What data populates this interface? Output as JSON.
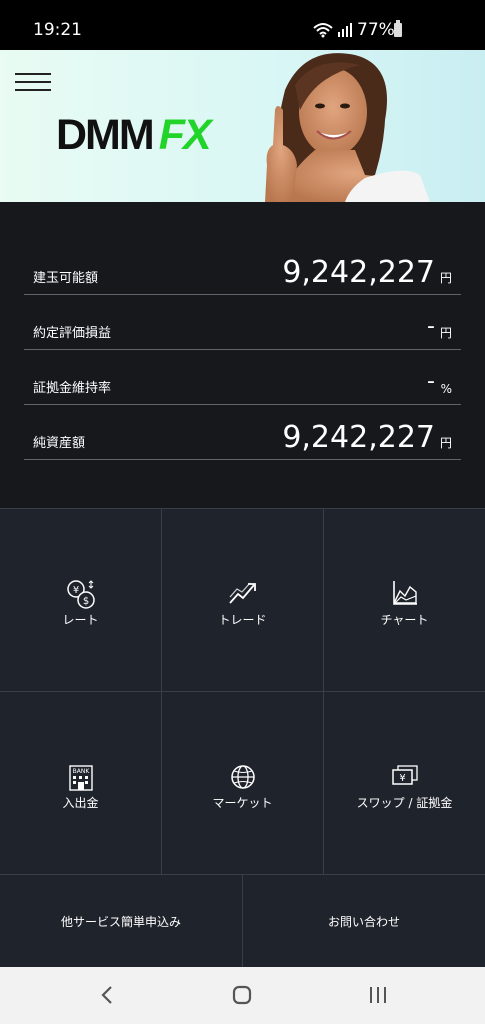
{
  "status": {
    "time": "19:21",
    "battery": "77%"
  },
  "hero": {
    "logo_dmm": "DMM",
    "logo_fx": "FX"
  },
  "summary": [
    {
      "label": "建玉可能額",
      "value": "9,242,227",
      "unit": "円"
    },
    {
      "label": "約定評価損益",
      "value": "-",
      "unit": "円"
    },
    {
      "label": "証拠金維持率",
      "value": "-",
      "unit": "%"
    },
    {
      "label": "純資産額",
      "value": "9,242,227",
      "unit": "円"
    }
  ],
  "menu": {
    "rate": "レート",
    "trade": "トレード",
    "chart": "チャート",
    "deposit": "入出金",
    "market": "マーケット",
    "swap": "スワップ / 証拠金",
    "other_services": "他サービス簡単申込み",
    "contact": "お問い合わせ"
  },
  "icons": {
    "rate": "currency-exchange-icon",
    "trade": "trend-chart-icon",
    "chart": "area-chart-icon",
    "deposit": "bank-icon",
    "market": "globe-icon",
    "swap": "yen-notes-icon"
  },
  "colors": {
    "accent_green": "#22d42a",
    "panel": "#1f232b",
    "background": "#16181c"
  }
}
